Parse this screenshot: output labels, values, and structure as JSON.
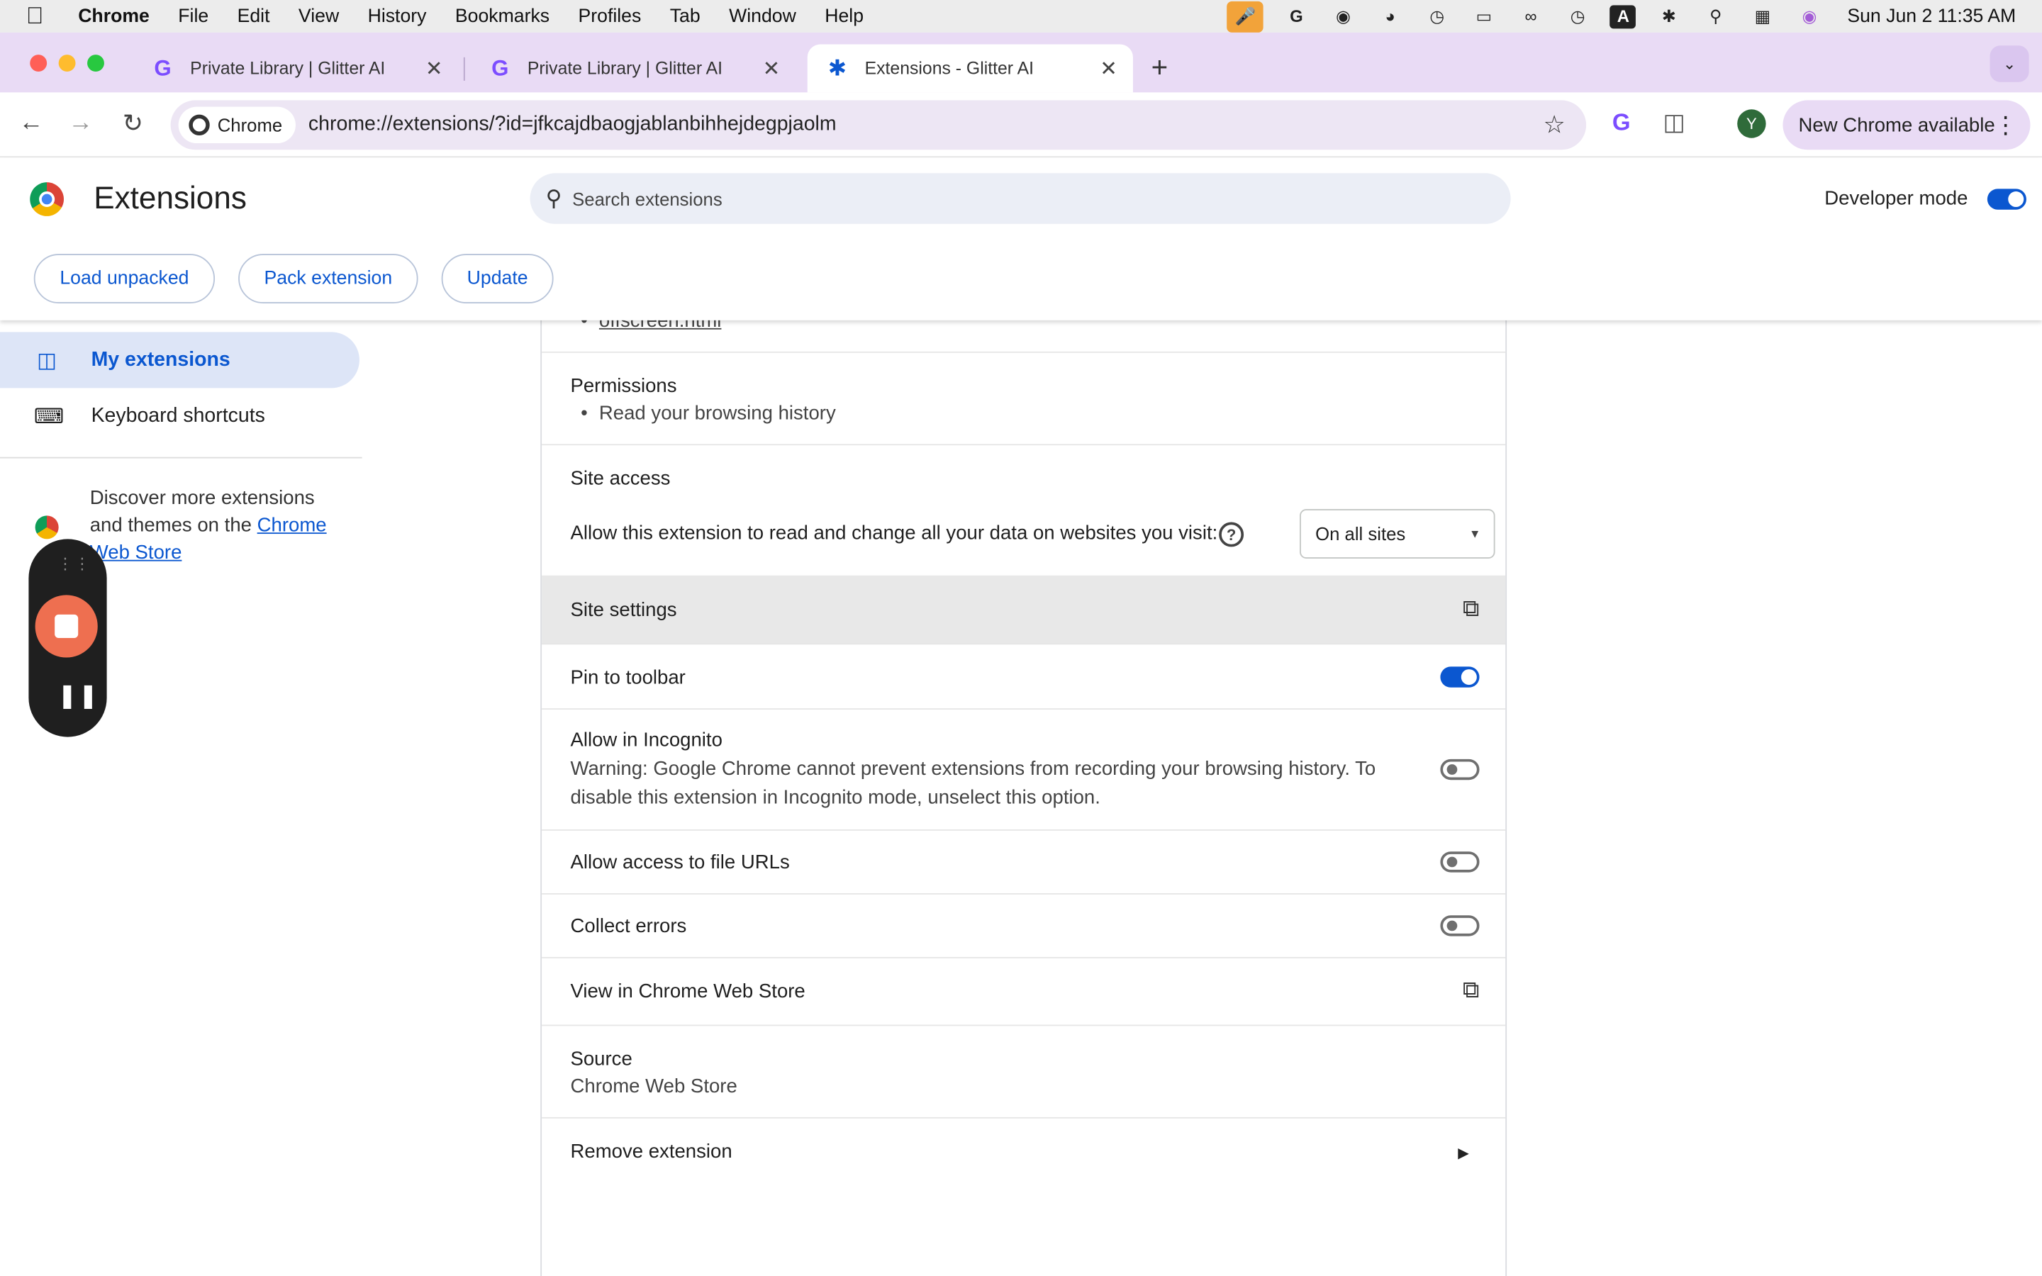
{
  "menubar": {
    "app": "Chrome",
    "items": [
      "File",
      "Edit",
      "View",
      "History",
      "Bookmarks",
      "Profiles",
      "Tab",
      "Window",
      "Help"
    ],
    "clock": "Sun Jun 2  11:35 AM"
  },
  "tabs": [
    {
      "title": "Private Library | Glitter AI",
      "icon": "glitter-g-icon"
    },
    {
      "title": "Private Library | Glitter AI",
      "icon": "glitter-g-icon"
    },
    {
      "title": "Extensions - Glitter AI",
      "icon": "puzzle-icon"
    }
  ],
  "omnibox": {
    "chip": "Chrome",
    "url": "chrome://extensions/?id=jfkcajdbaogjablanbihhejdegpjaolm"
  },
  "profile_initial": "Y",
  "new_chrome": "New Chrome available",
  "header": {
    "title": "Extensions",
    "search_placeholder": "Search extensions",
    "dev_mode_label": "Developer mode",
    "dev_mode_on": true,
    "buttons": {
      "load": "Load unpacked",
      "pack": "Pack extension",
      "update": "Update"
    }
  },
  "sidebar": {
    "items": [
      {
        "label": "My extensions",
        "icon": "puzzle-icon",
        "active": true
      },
      {
        "label": "Keyboard shortcuts",
        "icon": "keyboard-icon",
        "active": false
      }
    ],
    "discover_text": "Discover more extensions and themes on the ",
    "discover_link": "Chrome Web Store"
  },
  "details": {
    "partial_link": "offscreen.html",
    "permissions_title": "Permissions",
    "permissions": [
      "Read your browsing history"
    ],
    "site_access_title": "Site access",
    "site_access_text": "Allow this extension to read and change all your data on websites you visit:",
    "site_access_value": "On all sites",
    "site_settings": "Site settings",
    "pin": {
      "label": "Pin to toolbar",
      "on": true
    },
    "incognito": {
      "label": "Allow in Incognito",
      "warning": "Warning: Google Chrome cannot prevent extensions from recording your browsing history. To disable this extension in Incognito mode, unselect this option.",
      "on": false
    },
    "file_urls": {
      "label": "Allow access to file URLs",
      "on": false
    },
    "collect_errors": {
      "label": "Collect errors",
      "on": false
    },
    "view_store": "View in Chrome Web Store",
    "source_title": "Source",
    "source_value": "Chrome Web Store",
    "remove": "Remove extension"
  },
  "colors": {
    "accent": "#0b57d0",
    "tabstrip": "#e9dbf5",
    "recorder_stop": "#ee6f50"
  }
}
